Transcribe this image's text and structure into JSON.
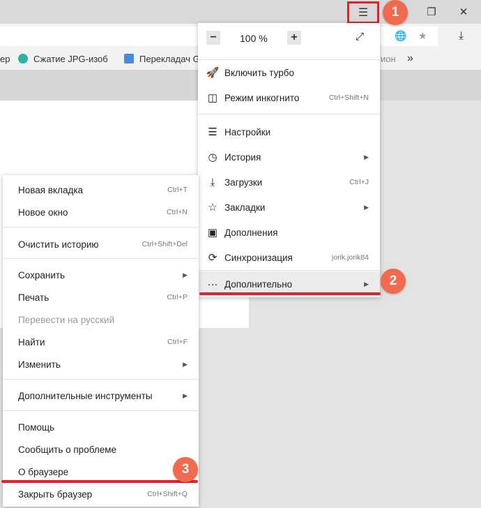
{
  "window": {
    "menu_icon": "hamburger-icon",
    "restore_icon": "restore-icon",
    "close_icon": "close-icon"
  },
  "toolbar": {
    "globe_icon": "globe-icon",
    "star_icon": "star-icon",
    "download_icon": "download-icon"
  },
  "bookmarks": {
    "items": [
      {
        "label": "ер"
      },
      {
        "label": "Сжатие JPG-изоб"
      },
      {
        "label": "Перекладач G"
      },
      {
        "label": "ион"
      }
    ],
    "more": "»"
  },
  "main_menu": {
    "zoom": {
      "minus": "−",
      "value": "100 %",
      "plus": "+"
    },
    "items": [
      {
        "label": "Включить турбо",
        "shortcut": ""
      },
      {
        "label": "Режим инкогнито",
        "shortcut": "Ctrl+Shift+N"
      },
      {
        "label": "Настройки",
        "shortcut": ""
      },
      {
        "label": "История",
        "shortcut": ""
      },
      {
        "label": "Загрузки",
        "shortcut": "Ctrl+J"
      },
      {
        "label": "Закладки",
        "shortcut": ""
      },
      {
        "label": "Дополнения",
        "shortcut": ""
      },
      {
        "label": "Синхронизация",
        "shortcut": "jorik.jorik84"
      },
      {
        "label": "Дополнительно",
        "shortcut": ""
      }
    ]
  },
  "sub_menu": {
    "items": [
      {
        "label": "Новая вкладка",
        "shortcut": "Ctrl+T"
      },
      {
        "label": "Новое окно",
        "shortcut": "Ctrl+N"
      },
      {
        "label": "Очистить историю",
        "shortcut": "Ctrl+Shift+Del"
      },
      {
        "label": "Сохранить",
        "shortcut": ""
      },
      {
        "label": "Печать",
        "shortcut": "Ctrl+P"
      },
      {
        "label": "Перевести на русский",
        "shortcut": ""
      },
      {
        "label": "Найти",
        "shortcut": "Ctrl+F"
      },
      {
        "label": "Изменить",
        "shortcut": ""
      },
      {
        "label": "Дополнительные инструменты",
        "shortcut": ""
      },
      {
        "label": "Помощь",
        "shortcut": ""
      },
      {
        "label": "Сообщить о проблеме",
        "shortcut": ""
      },
      {
        "label": "О браузере",
        "shortcut": ""
      },
      {
        "label": "Закрыть браузер",
        "shortcut": "Ctrl+Shift+Q"
      }
    ]
  },
  "annotations": {
    "step1": "1",
    "step2": "2",
    "step3": "3"
  },
  "colors": {
    "accent_red": "#e3222b",
    "badge": "#f26a4e"
  }
}
